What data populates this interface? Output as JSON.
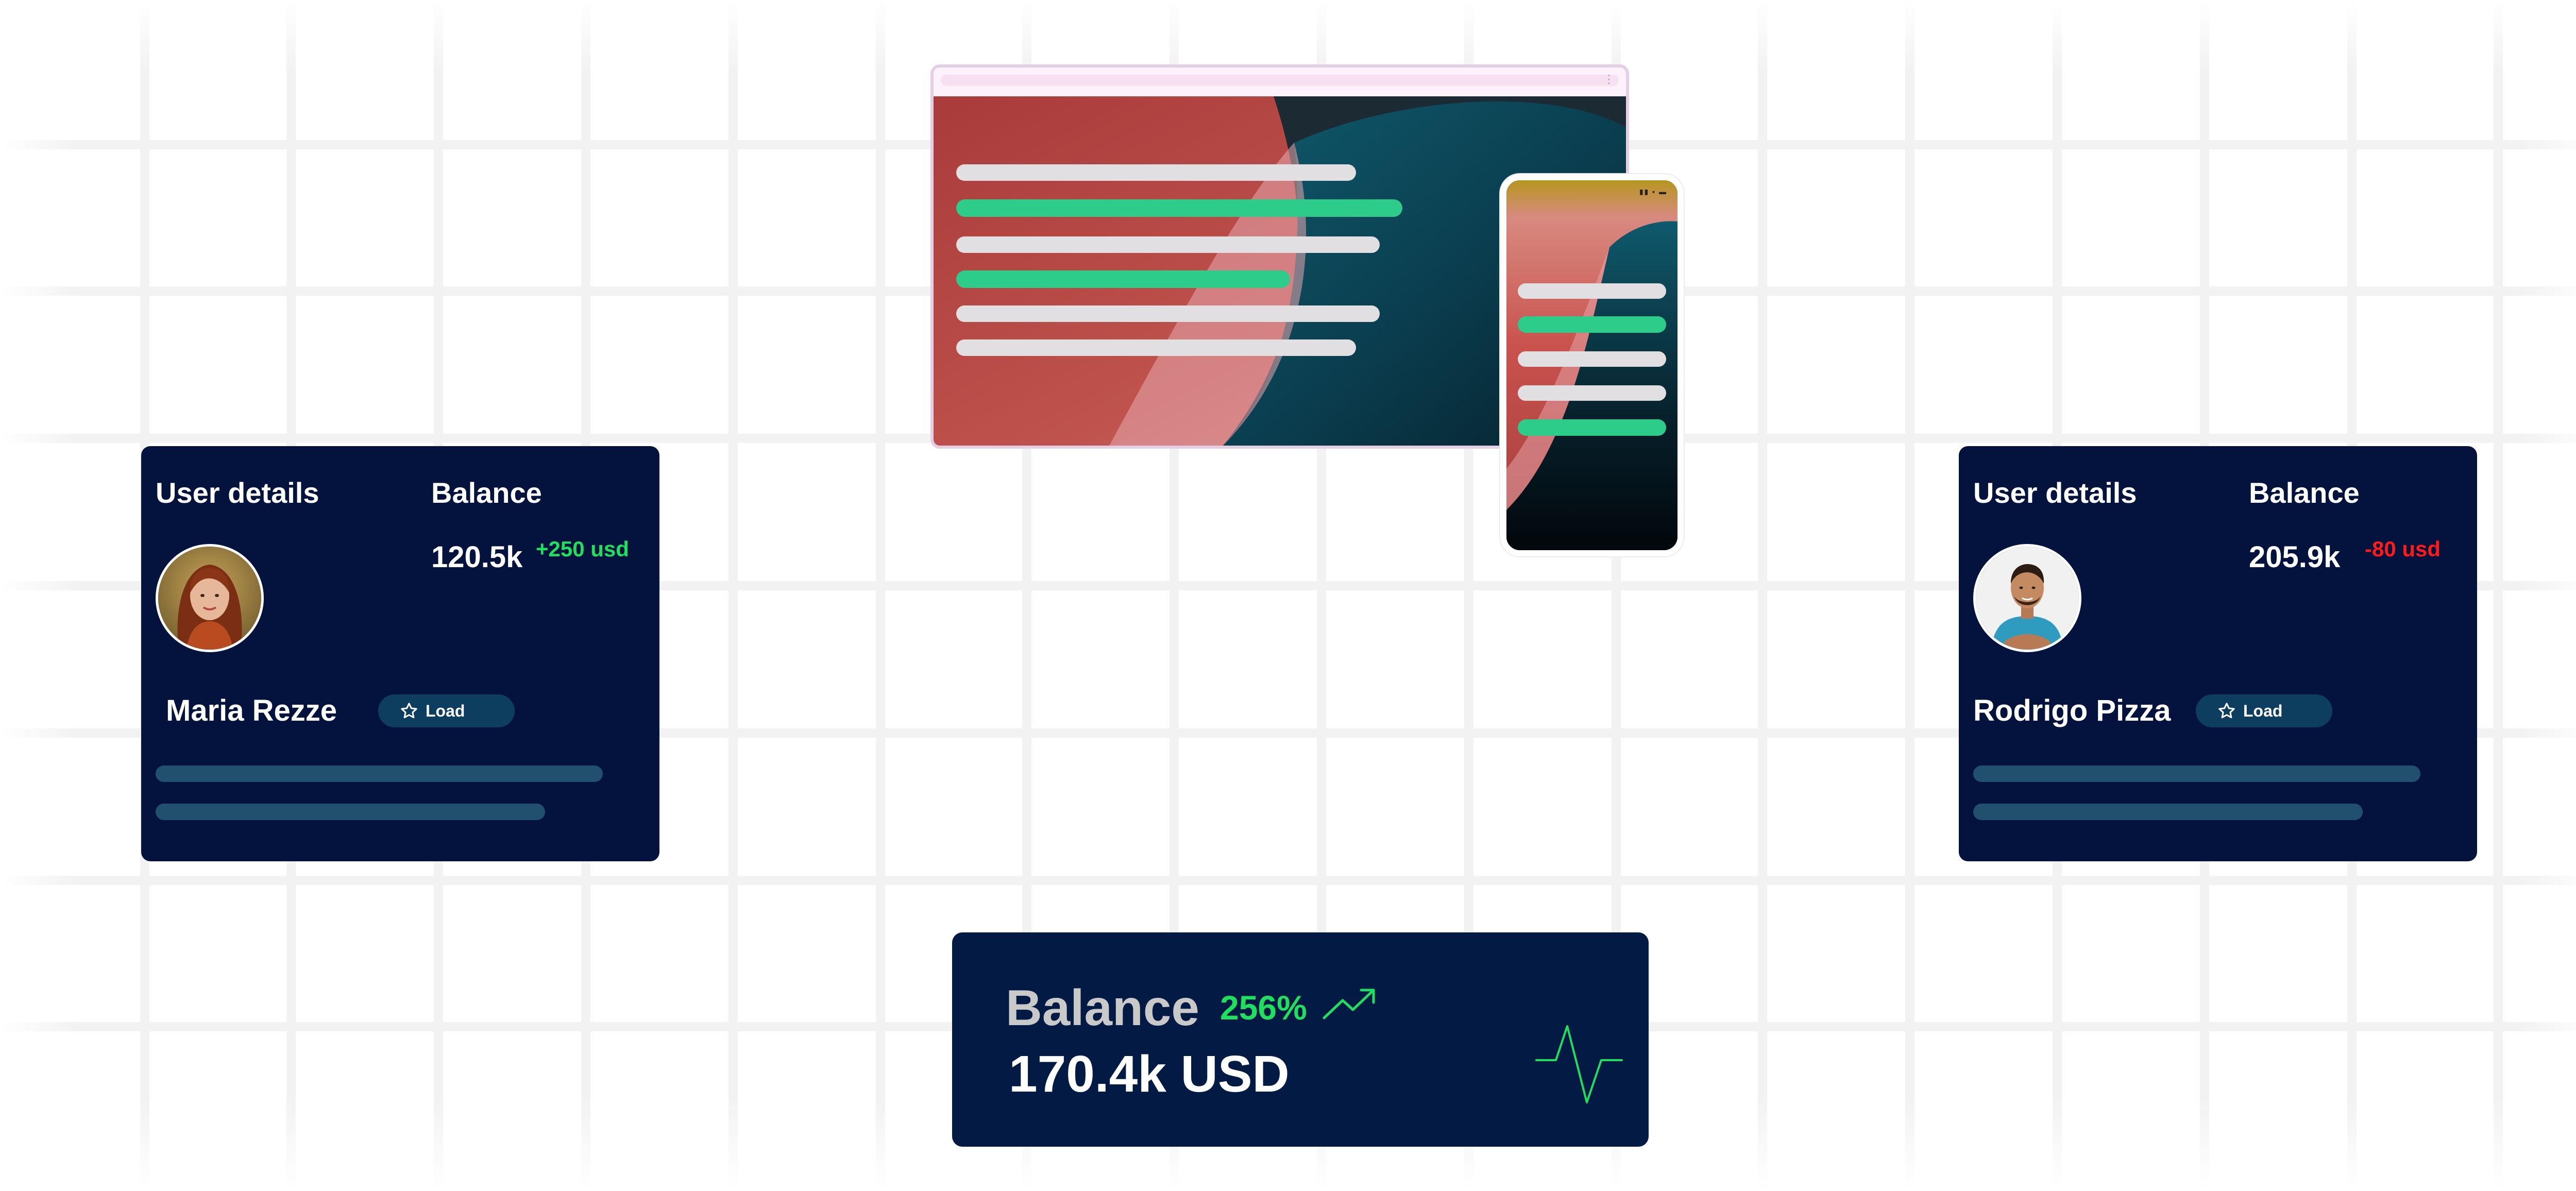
{
  "cards": [
    {
      "user_title": "User details",
      "balance_title": "Balance",
      "amount": "120.5k",
      "delta": "+250 usd",
      "delta_trend": "positive",
      "name": "Maria Rezze",
      "button_label": "Load",
      "button_icon": "star-icon",
      "avatar_icon": "woman-portrait-avatar"
    },
    {
      "user_title": "User details",
      "balance_title": "Balance",
      "amount": "205.9k",
      "delta": "-80 usd",
      "delta_trend": "negative",
      "name": "Rodrigo Pizza",
      "button_label": "Load",
      "button_icon": "star-icon",
      "avatar_icon": "man-portrait-avatar"
    }
  ],
  "balance_widget": {
    "title": "Balance",
    "percent": "256%",
    "amount": "170.4k USD",
    "trend_icon": "trend-up-icon",
    "pulse_icon": "pulse-icon"
  },
  "colors": {
    "card_bg": "#04133e",
    "positive": "#1fe05e",
    "negative": "#ff1a1a",
    "accent_green": "#2ecc8a",
    "widget_bg": "#031a44"
  }
}
